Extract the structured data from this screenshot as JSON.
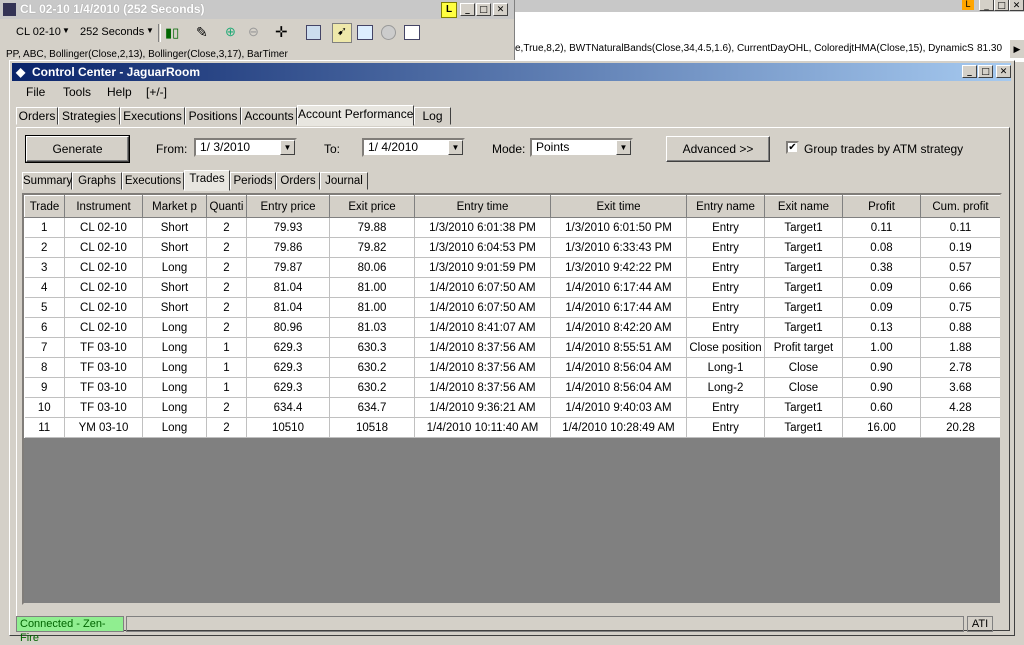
{
  "chart_window": {
    "title": "CL 02-10  1/4/2010 (252 Seconds)",
    "instrument": "CL 02-10",
    "interval": "252 Seconds",
    "badge": "L",
    "indicators": "PP, ABC, Bollinger(Close,2,13), Bollinger(Close,3,17), BarTimer"
  },
  "chart_window2": {
    "badge": "L",
    "indicators": "e,True,8,2), BWTNaturalBands(Close,34,4.5,1.6), CurrentDayOHL, ColoredjtHMA(Close,15), DynamicS",
    "price_label": "81.30"
  },
  "control_center": {
    "title": "Control Center - JaguarRoom",
    "menu": [
      "File",
      "Tools",
      "Help",
      "[+/-]"
    ],
    "main_tabs": [
      "Orders",
      "Strategies",
      "Executions",
      "Positions",
      "Accounts",
      "Account Performance",
      "Log"
    ],
    "active_main_tab": "Account Performance",
    "generate_label": "Generate",
    "from_label": "From:",
    "from_value": "1/  3/2010",
    "to_label": "To:",
    "to_value": "1/  4/2010",
    "mode_label": "Mode:",
    "mode_value": "Points",
    "advanced_label": "Advanced >>",
    "group_trades_label": "Group trades by ATM strategy",
    "group_trades_checked": true,
    "sub_tabs": [
      "Summary",
      "Graphs",
      "Executions",
      "Trades",
      "Periods",
      "Orders",
      "Journal"
    ],
    "active_sub_tab": "Trades",
    "columns": [
      "Trade",
      "Instrument",
      "Market p",
      "Quanti",
      "Entry price",
      "Exit price",
      "Entry time",
      "Exit time",
      "Entry name",
      "Exit name",
      "Profit",
      "Cum. profit"
    ],
    "rows": [
      [
        "1",
        "CL 02-10",
        "Short",
        "2",
        "79.93",
        "79.88",
        "1/3/2010 6:01:38 PM",
        "1/3/2010 6:01:50 PM",
        "Entry",
        "Target1",
        "0.11",
        "0.11"
      ],
      [
        "2",
        "CL 02-10",
        "Short",
        "2",
        "79.86",
        "79.82",
        "1/3/2010 6:04:53 PM",
        "1/3/2010 6:33:43 PM",
        "Entry",
        "Target1",
        "0.08",
        "0.19"
      ],
      [
        "3",
        "CL 02-10",
        "Long",
        "2",
        "79.87",
        "80.06",
        "1/3/2010 9:01:59 PM",
        "1/3/2010 9:42:22 PM",
        "Entry",
        "Target1",
        "0.38",
        "0.57"
      ],
      [
        "4",
        "CL 02-10",
        "Short",
        "2",
        "81.04",
        "81.00",
        "1/4/2010 6:07:50 AM",
        "1/4/2010 6:17:44 AM",
        "Entry",
        "Target1",
        "0.09",
        "0.66"
      ],
      [
        "5",
        "CL 02-10",
        "Short",
        "2",
        "81.04",
        "81.00",
        "1/4/2010 6:07:50 AM",
        "1/4/2010 6:17:44 AM",
        "Entry",
        "Target1",
        "0.09",
        "0.75"
      ],
      [
        "6",
        "CL 02-10",
        "Long",
        "2",
        "80.96",
        "81.03",
        "1/4/2010 8:41:07 AM",
        "1/4/2010 8:42:20 AM",
        "Entry",
        "Target1",
        "0.13",
        "0.88"
      ],
      [
        "7",
        "TF 03-10",
        "Long",
        "1",
        "629.3",
        "630.3",
        "1/4/2010 8:37:56 AM",
        "1/4/2010 8:55:51 AM",
        "Close position",
        "Profit target",
        "1.00",
        "1.88"
      ],
      [
        "8",
        "TF 03-10",
        "Long",
        "1",
        "629.3",
        "630.2",
        "1/4/2010 8:37:56 AM",
        "1/4/2010 8:56:04 AM",
        "Long-1",
        "Close",
        "0.90",
        "2.78"
      ],
      [
        "9",
        "TF 03-10",
        "Long",
        "1",
        "629.3",
        "630.2",
        "1/4/2010 8:37:56 AM",
        "1/4/2010 8:56:04 AM",
        "Long-2",
        "Close",
        "0.90",
        "3.68"
      ],
      [
        "10",
        "TF 03-10",
        "Long",
        "2",
        "634.4",
        "634.7",
        "1/4/2010 9:36:21 AM",
        "1/4/2010 9:40:03 AM",
        "Entry",
        "Target1",
        "0.60",
        "4.28"
      ],
      [
        "11",
        "YM 03-10",
        "Long",
        "2",
        "10510",
        "10518",
        "1/4/2010 10:11:40 AM",
        "1/4/2010 10:28:49 AM",
        "Entry",
        "Target1",
        "16.00",
        "20.28"
      ]
    ],
    "status_connection": "Connected - Zen-Fire",
    "status_right": "ATI",
    "colors": {
      "title_gradient_start": "#0a246a",
      "title_gradient_end": "#a6caf0",
      "grid_empty": "#808080",
      "connected_bg": "#90ee90"
    }
  }
}
